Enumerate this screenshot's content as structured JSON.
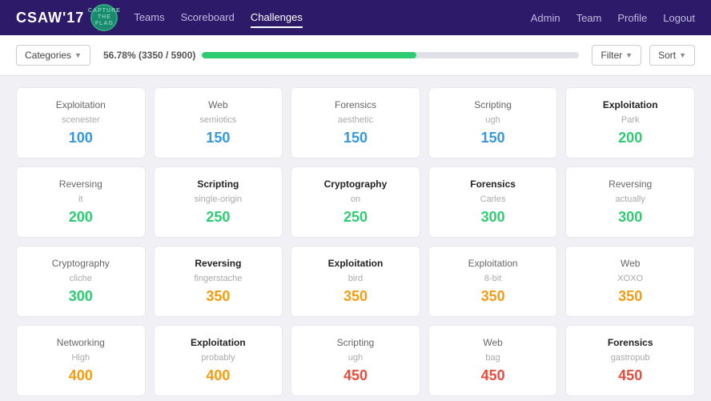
{
  "nav": {
    "brand": "CSAW'17",
    "ctf_lines": [
      "CAPTURE",
      "THE FLAG"
    ],
    "links": [
      "Teams",
      "Scoreboard",
      "Challenges"
    ],
    "active_link": "Challenges",
    "right_links": [
      "Admin",
      "Team",
      "Profile",
      "Logout"
    ]
  },
  "toolbar": {
    "categories_label": "Categories",
    "progress_text": "56.78% (3350 / 5900)",
    "progress_pct": 56.78,
    "filter_label": "Filter",
    "sort_label": "Sort"
  },
  "cards": [
    {
      "category": "Exploitation",
      "name": "scenester",
      "points": 100,
      "pts_class": "pts-100",
      "bold": false
    },
    {
      "category": "Web",
      "name": "semiotics",
      "points": 150,
      "pts_class": "pts-150",
      "bold": false
    },
    {
      "category": "Forensics",
      "name": "aesthetic",
      "points": 150,
      "pts_class": "pts-150",
      "bold": false
    },
    {
      "category": "Scripting",
      "name": "ugh",
      "points": 150,
      "pts_class": "pts-150",
      "bold": false
    },
    {
      "category": "Exploitation",
      "name": "Park",
      "points": 200,
      "pts_class": "pts-200",
      "bold": true
    },
    {
      "category": "Reversing",
      "name": "it",
      "points": 200,
      "pts_class": "pts-200",
      "bold": false
    },
    {
      "category": "Scripting",
      "name": "single-origin",
      "points": 250,
      "pts_class": "pts-250",
      "bold": true
    },
    {
      "category": "Cryptography",
      "name": "on",
      "points": 250,
      "pts_class": "pts-250",
      "bold": true
    },
    {
      "category": "Forensics",
      "name": "Carles",
      "points": 300,
      "pts_class": "pts-300",
      "bold": true
    },
    {
      "category": "Reversing",
      "name": "actually",
      "points": 300,
      "pts_class": "pts-300",
      "bold": false
    },
    {
      "category": "Cryptography",
      "name": "cliche",
      "points": 300,
      "pts_class": "pts-300",
      "bold": false
    },
    {
      "category": "Reversing",
      "name": "fingerstache",
      "points": 350,
      "pts_class": "pts-350",
      "bold": true
    },
    {
      "category": "Exploitation",
      "name": "bird",
      "points": 350,
      "pts_class": "pts-350",
      "bold": true
    },
    {
      "category": "Exploitation",
      "name": "8-bit",
      "points": 350,
      "pts_class": "pts-350",
      "bold": false
    },
    {
      "category": "Web",
      "name": "XOXO",
      "points": 350,
      "pts_class": "pts-350",
      "bold": false
    },
    {
      "category": "Networking",
      "name": "High",
      "points": 400,
      "pts_class": "pts-400",
      "bold": false
    },
    {
      "category": "Exploitation",
      "name": "probably",
      "points": 400,
      "pts_class": "pts-400",
      "bold": true
    },
    {
      "category": "Scripting",
      "name": "ugh",
      "points": 450,
      "pts_class": "pts-450",
      "bold": false
    },
    {
      "category": "Web",
      "name": "bag",
      "points": 450,
      "pts_class": "pts-450",
      "bold": false
    },
    {
      "category": "Forensics",
      "name": "gastropub",
      "points": 450,
      "pts_class": "pts-450",
      "bold": true
    }
  ]
}
